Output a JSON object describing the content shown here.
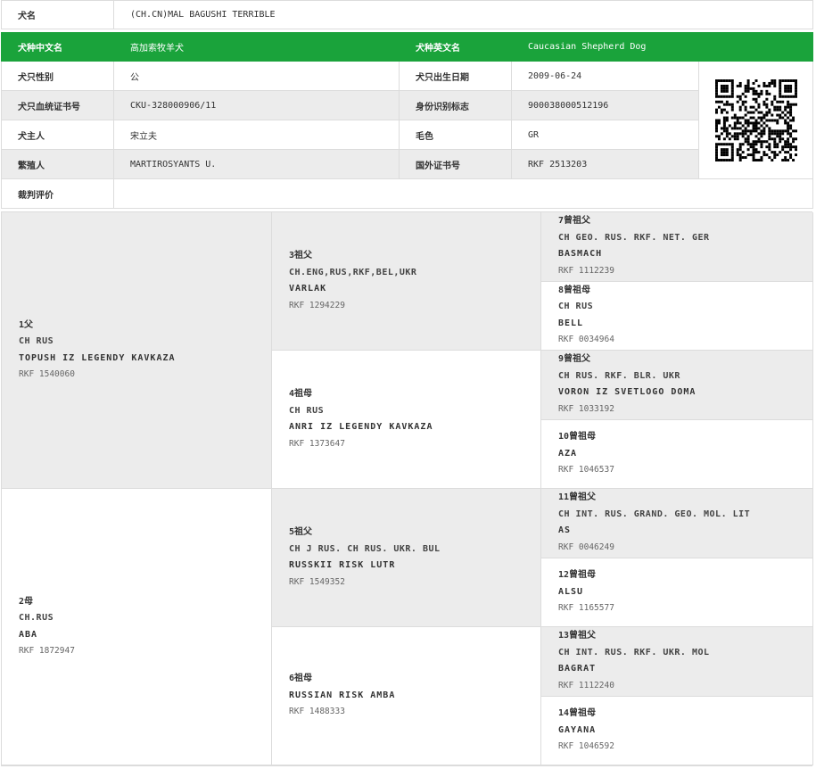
{
  "info": {
    "name_label": "犬名",
    "name_value": "(CH.CN)MAL BAGUSHI TERRIBLE",
    "breed_cn_label": "犬种中文名",
    "breed_cn_value": "高加索牧羊犬",
    "breed_en_label": "犬种英文名",
    "breed_en_value": "Caucasian Shepherd Dog",
    "sex_label": "犬只性别",
    "sex_value": "公",
    "birth_label": "犬只出生日期",
    "birth_value": "2009-06-24",
    "cert_label": "犬只血统证书号",
    "cert_value": "CKU-328000906/11",
    "chip_label": "身份识别标志",
    "chip_value": "900038000512196",
    "owner_label": "犬主人",
    "owner_value": "宋立夫",
    "color_label": "毛色",
    "color_value": "GR",
    "breeder_label": "繁殖人",
    "breeder_value": "MARTIROSYANTS U.",
    "foreign_label": "国外证书号",
    "foreign_value": "RKF 2513203",
    "judge_label": "裁判评价",
    "judge_value": ""
  },
  "pedigree": {
    "p1": {
      "label": "1父",
      "title": "CH RUS",
      "name": "TOPUSH IZ LEGENDY KAVKAZA",
      "reg": "RKF 1540060"
    },
    "p2": {
      "label": "2母",
      "title": "CH.RUS",
      "name": "ABA",
      "reg": "RKF 1872947"
    },
    "p3": {
      "label": "3祖父",
      "title": "CH.ENG,RUS,RKF,BEL,UKR",
      "name": "VARLAK",
      "reg": "RKF 1294229"
    },
    "p4": {
      "label": "4祖母",
      "title": "CH RUS",
      "name": "ANRI IZ LEGENDY KAVKAZA",
      "reg": "RKF 1373647"
    },
    "p5": {
      "label": "5祖父",
      "title": "CH J RUS. CH RUS. UKR. BUL",
      "name": "RUSSKII RISK LUTR",
      "reg": "RKF 1549352"
    },
    "p6": {
      "label": "6祖母",
      "title": "",
      "name": "RUSSIAN RISK AMBA",
      "reg": "RKF 1488333"
    },
    "p7": {
      "label": "7曾祖父",
      "title": "CH GEO. RUS. RKF. NET. GER",
      "name": "BASMACH",
      "reg": "RKF 1112239"
    },
    "p8": {
      "label": "8曾祖母",
      "title": "CH RUS",
      "name": "BELL",
      "reg": "RKF 0034964"
    },
    "p9": {
      "label": "9曾祖父",
      "title": "CH RUS. RKF. BLR. UKR",
      "name": "VORON IZ SVETLOGO DOMA",
      "reg": "RKF 1033192"
    },
    "p10": {
      "label": "10曾祖母",
      "title": "",
      "name": "AZA",
      "reg": "RKF 1046537"
    },
    "p11": {
      "label": "11曾祖父",
      "title": "CH INT. RUS. GRAND. GEO. MOL. LIT",
      "name": "AS",
      "reg": "RKF 0046249"
    },
    "p12": {
      "label": "12曾祖母",
      "title": "",
      "name": "ALSU",
      "reg": "RKF 1165577"
    },
    "p13": {
      "label": "13曾祖父",
      "title": "CH INT. RUS. RKF. UKR. MOL",
      "name": "BAGRAT",
      "reg": "RKF 1112240"
    },
    "p14": {
      "label": "14曾祖母",
      "title": "",
      "name": "GAYANA",
      "reg": "RKF 1046592"
    }
  },
  "qr": {
    "icon": "qr-code-icon"
  }
}
